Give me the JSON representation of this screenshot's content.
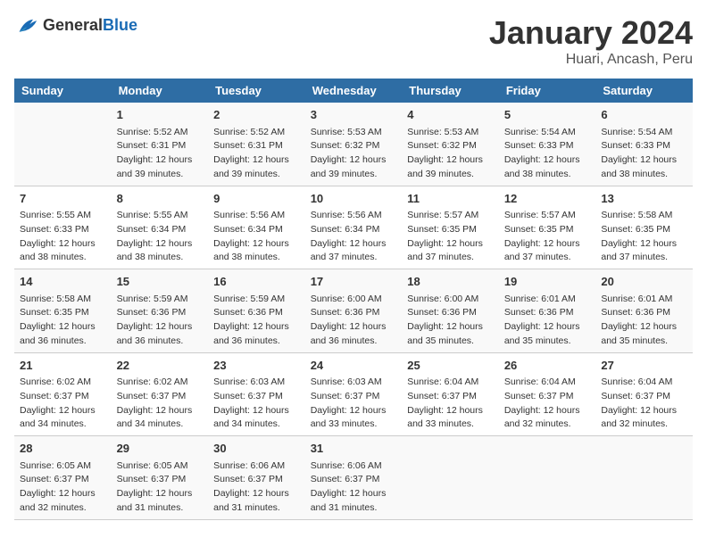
{
  "logo": {
    "general": "General",
    "blue": "Blue"
  },
  "title": "January 2024",
  "location": "Huari, Ancash, Peru",
  "days_header": [
    "Sunday",
    "Monday",
    "Tuesday",
    "Wednesday",
    "Thursday",
    "Friday",
    "Saturday"
  ],
  "weeks": [
    [
      {
        "day": "",
        "info": ""
      },
      {
        "day": "1",
        "info": "Sunrise: 5:52 AM\nSunset: 6:31 PM\nDaylight: 12 hours\nand 39 minutes."
      },
      {
        "day": "2",
        "info": "Sunrise: 5:52 AM\nSunset: 6:31 PM\nDaylight: 12 hours\nand 39 minutes."
      },
      {
        "day": "3",
        "info": "Sunrise: 5:53 AM\nSunset: 6:32 PM\nDaylight: 12 hours\nand 39 minutes."
      },
      {
        "day": "4",
        "info": "Sunrise: 5:53 AM\nSunset: 6:32 PM\nDaylight: 12 hours\nand 39 minutes."
      },
      {
        "day": "5",
        "info": "Sunrise: 5:54 AM\nSunset: 6:33 PM\nDaylight: 12 hours\nand 38 minutes."
      },
      {
        "day": "6",
        "info": "Sunrise: 5:54 AM\nSunset: 6:33 PM\nDaylight: 12 hours\nand 38 minutes."
      }
    ],
    [
      {
        "day": "7",
        "info": "Sunrise: 5:55 AM\nSunset: 6:33 PM\nDaylight: 12 hours\nand 38 minutes."
      },
      {
        "day": "8",
        "info": "Sunrise: 5:55 AM\nSunset: 6:34 PM\nDaylight: 12 hours\nand 38 minutes."
      },
      {
        "day": "9",
        "info": "Sunrise: 5:56 AM\nSunset: 6:34 PM\nDaylight: 12 hours\nand 38 minutes."
      },
      {
        "day": "10",
        "info": "Sunrise: 5:56 AM\nSunset: 6:34 PM\nDaylight: 12 hours\nand 37 minutes."
      },
      {
        "day": "11",
        "info": "Sunrise: 5:57 AM\nSunset: 6:35 PM\nDaylight: 12 hours\nand 37 minutes."
      },
      {
        "day": "12",
        "info": "Sunrise: 5:57 AM\nSunset: 6:35 PM\nDaylight: 12 hours\nand 37 minutes."
      },
      {
        "day": "13",
        "info": "Sunrise: 5:58 AM\nSunset: 6:35 PM\nDaylight: 12 hours\nand 37 minutes."
      }
    ],
    [
      {
        "day": "14",
        "info": "Sunrise: 5:58 AM\nSunset: 6:35 PM\nDaylight: 12 hours\nand 36 minutes."
      },
      {
        "day": "15",
        "info": "Sunrise: 5:59 AM\nSunset: 6:36 PM\nDaylight: 12 hours\nand 36 minutes."
      },
      {
        "day": "16",
        "info": "Sunrise: 5:59 AM\nSunset: 6:36 PM\nDaylight: 12 hours\nand 36 minutes."
      },
      {
        "day": "17",
        "info": "Sunrise: 6:00 AM\nSunset: 6:36 PM\nDaylight: 12 hours\nand 36 minutes."
      },
      {
        "day": "18",
        "info": "Sunrise: 6:00 AM\nSunset: 6:36 PM\nDaylight: 12 hours\nand 35 minutes."
      },
      {
        "day": "19",
        "info": "Sunrise: 6:01 AM\nSunset: 6:36 PM\nDaylight: 12 hours\nand 35 minutes."
      },
      {
        "day": "20",
        "info": "Sunrise: 6:01 AM\nSunset: 6:36 PM\nDaylight: 12 hours\nand 35 minutes."
      }
    ],
    [
      {
        "day": "21",
        "info": "Sunrise: 6:02 AM\nSunset: 6:37 PM\nDaylight: 12 hours\nand 34 minutes."
      },
      {
        "day": "22",
        "info": "Sunrise: 6:02 AM\nSunset: 6:37 PM\nDaylight: 12 hours\nand 34 minutes."
      },
      {
        "day": "23",
        "info": "Sunrise: 6:03 AM\nSunset: 6:37 PM\nDaylight: 12 hours\nand 34 minutes."
      },
      {
        "day": "24",
        "info": "Sunrise: 6:03 AM\nSunset: 6:37 PM\nDaylight: 12 hours\nand 33 minutes."
      },
      {
        "day": "25",
        "info": "Sunrise: 6:04 AM\nSunset: 6:37 PM\nDaylight: 12 hours\nand 33 minutes."
      },
      {
        "day": "26",
        "info": "Sunrise: 6:04 AM\nSunset: 6:37 PM\nDaylight: 12 hours\nand 32 minutes."
      },
      {
        "day": "27",
        "info": "Sunrise: 6:04 AM\nSunset: 6:37 PM\nDaylight: 12 hours\nand 32 minutes."
      }
    ],
    [
      {
        "day": "28",
        "info": "Sunrise: 6:05 AM\nSunset: 6:37 PM\nDaylight: 12 hours\nand 32 minutes."
      },
      {
        "day": "29",
        "info": "Sunrise: 6:05 AM\nSunset: 6:37 PM\nDaylight: 12 hours\nand 31 minutes."
      },
      {
        "day": "30",
        "info": "Sunrise: 6:06 AM\nSunset: 6:37 PM\nDaylight: 12 hours\nand 31 minutes."
      },
      {
        "day": "31",
        "info": "Sunrise: 6:06 AM\nSunset: 6:37 PM\nDaylight: 12 hours\nand 31 minutes."
      },
      {
        "day": "",
        "info": ""
      },
      {
        "day": "",
        "info": ""
      },
      {
        "day": "",
        "info": ""
      }
    ]
  ]
}
